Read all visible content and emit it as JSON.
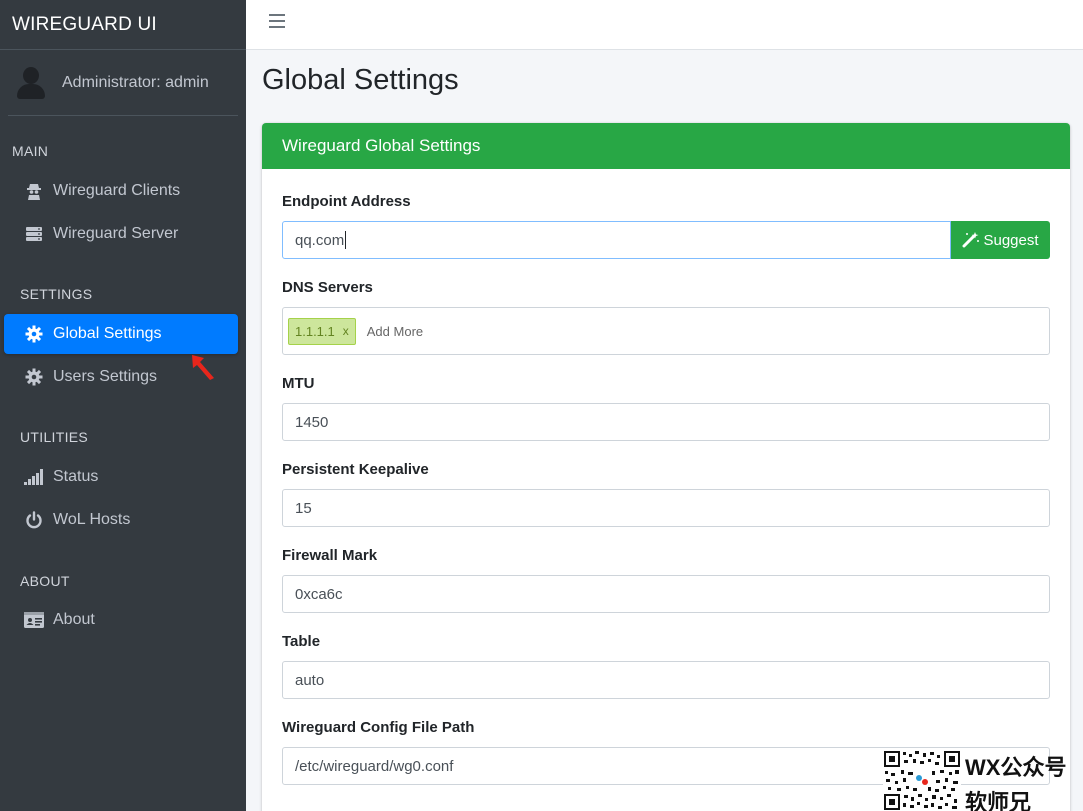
{
  "brand": "WIREGUARD UI",
  "user": {
    "name": "Administrator: admin"
  },
  "sidebar": {
    "sections": [
      {
        "header": "MAIN",
        "items": [
          {
            "label": "Wireguard Clients",
            "icon": "user-secret-icon"
          },
          {
            "label": "Wireguard Server",
            "icon": "server-icon"
          }
        ]
      },
      {
        "header": "SETTINGS",
        "items": [
          {
            "label": "Global Settings",
            "icon": "gear-icon",
            "active": true
          },
          {
            "label": "Users Settings",
            "icon": "gear-icon"
          }
        ]
      },
      {
        "header": "UTILITIES",
        "items": [
          {
            "label": "Status",
            "icon": "signal-icon"
          },
          {
            "label": "WoL Hosts",
            "icon": "power-icon"
          }
        ]
      },
      {
        "header": "ABOUT",
        "items": [
          {
            "label": "About",
            "icon": "id-card-icon"
          }
        ]
      }
    ]
  },
  "page": {
    "title": "Global Settings"
  },
  "card": {
    "title": "Wireguard Global Settings",
    "fields": {
      "endpoint": {
        "label": "Endpoint Address",
        "value": "qq.com",
        "button": "Suggest"
      },
      "dns": {
        "label": "DNS Servers",
        "tags": [
          "1.1.1.1"
        ],
        "tag_remove": "x",
        "placeholder": "Add More"
      },
      "mtu": {
        "label": "MTU",
        "value": "1450"
      },
      "keepalive": {
        "label": "Persistent Keepalive",
        "value": "15"
      },
      "fwmark": {
        "label": "Firewall Mark",
        "value": "0xca6c"
      },
      "table": {
        "label": "Table",
        "value": "auto"
      },
      "config_path": {
        "label": "Wireguard Config File Path",
        "value": "/etc/wireguard/wg0.conf"
      }
    }
  },
  "watermark": {
    "line1": "WX公众号",
    "line2": "软师兄"
  },
  "colors": {
    "sidebar_bg": "#343a40",
    "active": "#007bff",
    "success": "#28a745",
    "annotation_arrow": "#e8261c"
  }
}
